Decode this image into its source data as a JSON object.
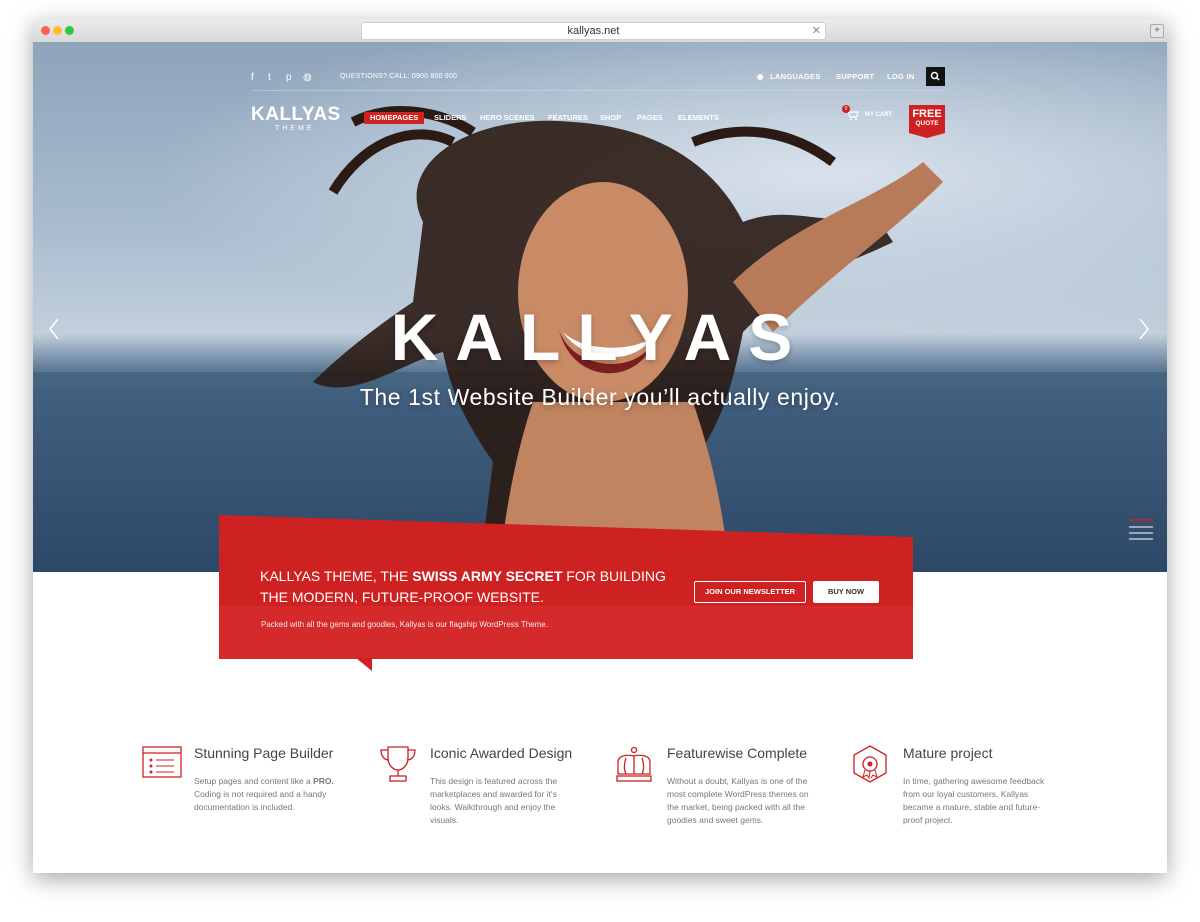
{
  "browser": {
    "url": "kallyas.net"
  },
  "topbar": {
    "social_icons": [
      "facebook-icon",
      "twitter-icon",
      "pinterest-icon",
      "instagram-icon"
    ],
    "phone_text": "QUESTIONS? CALL: 0900 800 900",
    "languages": "LANGUAGES",
    "support": "SUPPORT",
    "login": "LOG IN"
  },
  "header": {
    "logo": "KALLYAS",
    "logo_sub": "THEME",
    "nav": [
      "HOMEPAGES",
      "SLIDERS",
      "HERO SCENES",
      "FEATURES",
      "SHOP",
      "PAGES",
      "ELEMENTS"
    ],
    "cart_count": "0",
    "cart_label": "MY CART",
    "quote_line1": "FREE",
    "quote_line2": "QUOTE"
  },
  "hero": {
    "title": "KALLYAS",
    "subtitle": "The 1st Website Builder you’ll actually enjoy."
  },
  "promo": {
    "title_part1": "KALLYAS THEME, THE ",
    "title_bold": "SWISS ARMY SECRET",
    "title_part2": " FOR BUILDING THE MODERN, FUTURE-PROOF WEBSITE.",
    "description": "Packed with all the gems and goodies, Kallyas is our flagship WordPress Theme.",
    "newsletter_button": "JOIN OUR NEWSLETTER",
    "buy_button": "BUY NOW"
  },
  "features": [
    {
      "title": "Stunning Page Builder",
      "text_a": "Setup pages and content like a ",
      "text_bold": "PRO.",
      "text_b": " Coding is not required and a handy documentation is included.",
      "icon": "page-builder-icon"
    },
    {
      "title": "Iconic Awarded Design",
      "text": "This design is featured across the marketplaces and awarded for it's looks. Walkthrough and enjoy the visuals.",
      "icon": "trophy-icon"
    },
    {
      "title": "Featurewise Complete",
      "text": "Without a doubt, Kallyas is one of the most complete WordPress themes on the market, being packed with all the goodies and sweet gems.",
      "icon": "crown-icon"
    },
    {
      "title": "Mature project",
      "text": "In time, gathering awesome feedback from our loyal customers, Kallyas became a mature, stable and future-proof project.",
      "icon": "badge-icon"
    }
  ],
  "colors": {
    "accent": "#cd2122"
  }
}
